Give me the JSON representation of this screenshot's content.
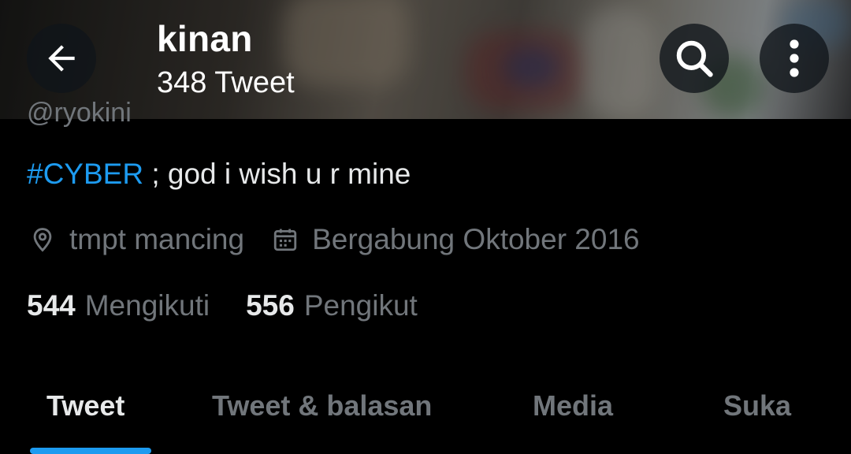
{
  "header": {
    "profile_name": "kinan",
    "tweet_count": "348 Tweet",
    "icons": {
      "back": "arrow-left-icon",
      "search": "search-icon",
      "more": "more-vertical-icon"
    }
  },
  "profile": {
    "handle_partial": "@ryokini",
    "bio_hashtag": "#CYBER",
    "bio_text": " ; god i wish u r mine",
    "location": "tmpt mancing",
    "joined": "Bergabung Oktober 2016",
    "following_count": "544",
    "following_label": "Mengikuti",
    "followers_count": "556",
    "followers_label": "Pengikut"
  },
  "tabs": [
    {
      "label": "Tweet",
      "active": true
    },
    {
      "label": "Tweet & balasan",
      "active": false
    },
    {
      "label": "Media",
      "active": false
    },
    {
      "label": "Suka",
      "active": false
    }
  ],
  "colors": {
    "accent": "#1d9bf0",
    "secondary_text": "#71767b",
    "primary_text": "#e7e9ea",
    "background": "#000000"
  }
}
